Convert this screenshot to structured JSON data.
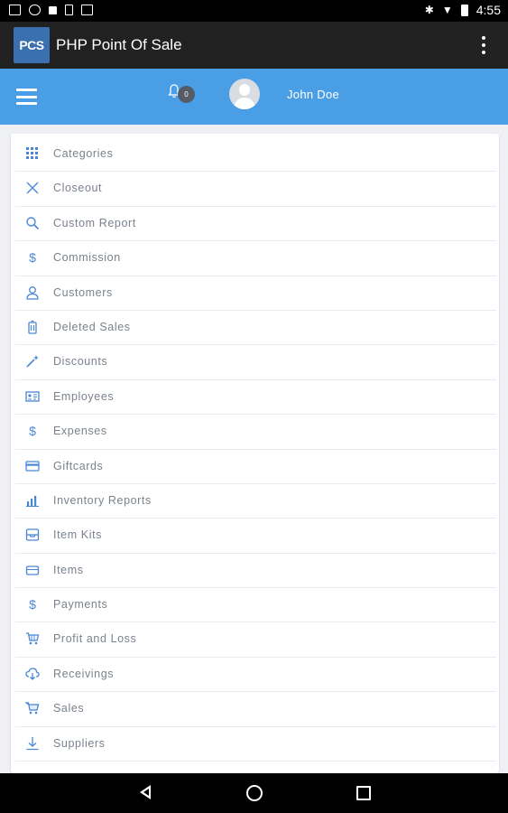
{
  "status_bar": {
    "time": "4:55",
    "left_icons": [
      "photo-notification-icon",
      "cloud-upload-icon",
      "stop-icon",
      "phone-icon",
      "briefcase-icon"
    ],
    "right_icons": [
      "bluetooth-icon",
      "wifi-icon",
      "battery-icon"
    ]
  },
  "app_bar": {
    "logo_text": "PCS",
    "title": "PHP Point Of Sale",
    "overflow_icon": "more-vertical-icon"
  },
  "header": {
    "bg_color": "#4a9ee6",
    "notification_count": "0",
    "user_name": "John Doe"
  },
  "menu": {
    "accent_color": "#4a86d6",
    "items": [
      {
        "label": "Categories",
        "icon": "grid-icon"
      },
      {
        "label": "Closeout",
        "icon": "close-icon"
      },
      {
        "label": "Custom Report",
        "icon": "search-icon"
      },
      {
        "label": "Commission",
        "icon": "dollar-icon"
      },
      {
        "label": "Customers",
        "icon": "person-icon"
      },
      {
        "label": "Deleted Sales",
        "icon": "trash-icon"
      },
      {
        "label": "Discounts",
        "icon": "magic-wand-icon"
      },
      {
        "label": "Employees",
        "icon": "id-card-icon"
      },
      {
        "label": "Expenses",
        "icon": "dollar-icon"
      },
      {
        "label": "Giftcards",
        "icon": "credit-card-icon"
      },
      {
        "label": "Inventory Reports",
        "icon": "bar-chart-icon"
      },
      {
        "label": "Item Kits",
        "icon": "inbox-icon"
      },
      {
        "label": "Items",
        "icon": "tag-icon"
      },
      {
        "label": "Payments",
        "icon": "dollar-icon"
      },
      {
        "label": "Profit and Loss",
        "icon": "cart-icon"
      },
      {
        "label": "Receivings",
        "icon": "cloud-download-icon"
      },
      {
        "label": "Sales",
        "icon": "shopping-cart-icon"
      },
      {
        "label": "Suppliers",
        "icon": "download-icon"
      }
    ]
  },
  "nav_bar": {
    "icons": [
      "back-icon",
      "home-icon",
      "recent-apps-icon"
    ]
  }
}
